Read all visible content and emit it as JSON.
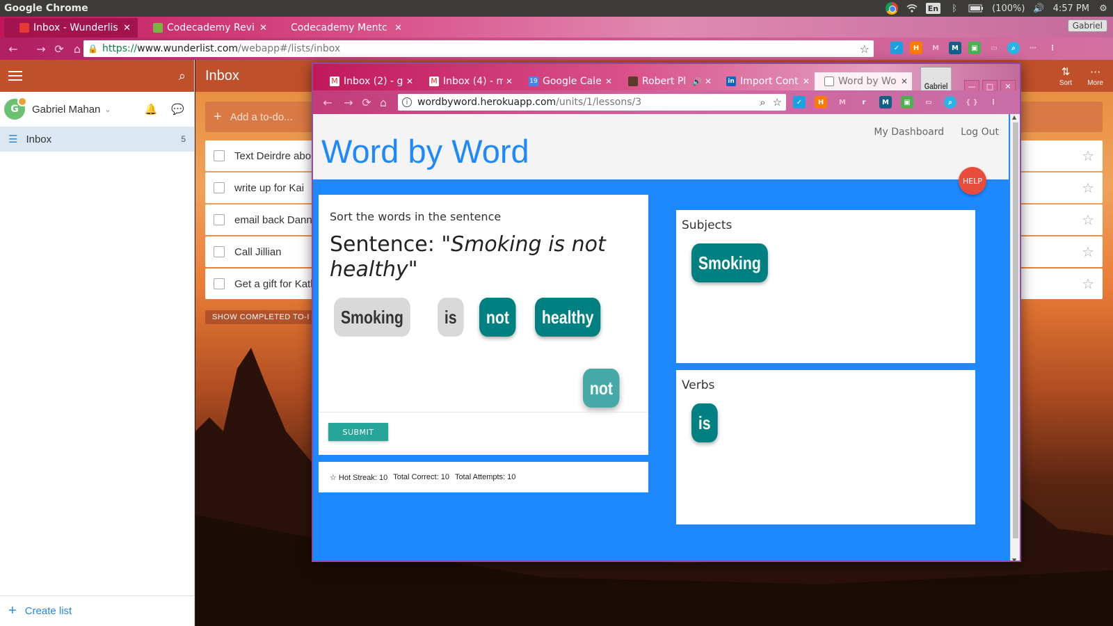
{
  "system": {
    "app_name": "Google Chrome",
    "lang": "En",
    "battery": "(100%)",
    "clock": "4:57 PM"
  },
  "outer_browser": {
    "tabs": [
      {
        "title": "Inbox - Wunderlist",
        "favicon_color": "#e53935",
        "active": true
      },
      {
        "title": "Codecademy Revie",
        "favicon_color": "#7cb342",
        "active": false
      },
      {
        "title": "Codecademy Mentc",
        "favicon_color": "",
        "active": false
      }
    ],
    "profile": "Gabriel",
    "url": {
      "scheme": "https://",
      "host": "www.wunderlist.com",
      "path": "/webapp#/lists/inbox"
    }
  },
  "wunderlist": {
    "user_name": "Gabriel Mahan",
    "avatar_initial": "G",
    "sidebar_inbox_label": "Inbox",
    "sidebar_inbox_count": "5",
    "create_list_label": "Create list",
    "list_title": "Inbox",
    "header_buttons": [
      {
        "icon": "sort-icon",
        "label": "Sort"
      },
      {
        "icon": "more-icon",
        "label": "More"
      }
    ],
    "add_todo_placeholder": "Add a to-do...",
    "todos": [
      {
        "text": "Text Deirdre abou"
      },
      {
        "text": "write up for Kai"
      },
      {
        "text": "email back Danny"
      },
      {
        "text": "Call Jillian"
      },
      {
        "text": "Get a gift for Kath"
      }
    ],
    "show_completed_label": "SHOW COMPLETED TO-I"
  },
  "inner_browser": {
    "tabs": [
      {
        "title": "Inbox (2) - g",
        "favicon": "gmail"
      },
      {
        "title": "Inbox (4) - m",
        "favicon": "gmail"
      },
      {
        "title": "Google Cale",
        "favicon": "calendar",
        "favicon_text": "19"
      },
      {
        "title": "Robert Pl",
        "favicon": "audio"
      },
      {
        "title": "Import Cont",
        "favicon": "linkedin",
        "favicon_text": "in"
      },
      {
        "title": "Word by Wo",
        "favicon": "page",
        "active": true
      }
    ],
    "profile": "Gabriel",
    "url": {
      "host": "wordbyword.herokuapp.com",
      "path": "/units/1/lessons/3"
    }
  },
  "app": {
    "title": "Word by Word",
    "nav": {
      "dashboard": "My Dashboard",
      "logout": "Log Out"
    },
    "help_label": "HELP",
    "prompt": "Sort the words in the sentence",
    "sentence_label": "Sentence:",
    "sentence_text": "\"Smoking is not healthy\"",
    "word_chips": [
      {
        "word": "Smoking",
        "state": "placed"
      },
      {
        "word": "is",
        "state": "placed"
      },
      {
        "word": "not",
        "state": "available"
      },
      {
        "word": "healthy",
        "state": "available"
      }
    ],
    "dragging_chip": "not",
    "submit_label": "SUBMIT",
    "stats": {
      "hot_streak": "☆ Hot Streak: 10",
      "total_correct": "Total Correct: 10",
      "total_attempts": "Total Attempts: 10"
    },
    "buckets": [
      {
        "title": "Subjects",
        "words": [
          "Smoking"
        ]
      },
      {
        "title": "Verbs",
        "words": [
          "is"
        ]
      }
    ],
    "colors": {
      "primary": "#1e88ff",
      "chip_teal": "#008080",
      "help_red": "#e74c3c",
      "submit": "#26a69a"
    }
  }
}
